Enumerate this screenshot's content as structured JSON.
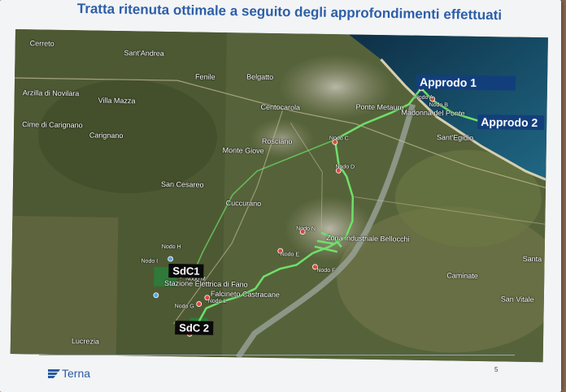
{
  "slide": {
    "title": "Tratta ritenuta ottimale a seguito degli approfondimenti effettuati",
    "page_number": "5"
  },
  "logo": {
    "text": "Terna"
  },
  "callouts": {
    "approdo1": "Approdo 1",
    "approdo2": "Approdo 2",
    "sdc1": "SdC1",
    "sdc2": "SdC 2"
  },
  "places": {
    "cerreto": "Cerreto",
    "sant_andrea": "Sant'Andrea",
    "fenile": "Fenile",
    "belgatto": "Belgatto",
    "arzilla": "Arzilla di Novilara",
    "villa_mazza": "Villa Mazza",
    "cento_carola": "Centocarola",
    "cime_carignano": "Cime di Carignano",
    "carignano": "Carignano",
    "monte_giove": "Monte Giove",
    "rosciano": "Rosciano",
    "san_cesareo": "San Cesareo",
    "sant_egidio": "Sant'Egidio",
    "madonna_ponte": "Madonna del Ponte",
    "ponte_metauro": "Ponte Metauro",
    "zona_industriale": "Zona industriale Bellocchi",
    "stazione_elettrica": "Stazione Elettrica di Fano",
    "falcineto": "Falcineto Castracane",
    "caminate": "Caminate",
    "san_vitale": "San Vitale",
    "lucrezia": "Lucrezia",
    "cuccurano": "Cuccurano",
    "santa": "Santa"
  },
  "nodes": {
    "nodo_a": "Nodo A",
    "nodo_b": "Nodo B",
    "nodo_c": "Nodo C",
    "nodo_d": "Nodo D",
    "nodo_e": "Nodo E",
    "nodo_f": "Nodo F",
    "nodo_g": "Nodo G",
    "nodo_h": "Nodo H",
    "nodo_i": "Nodo I",
    "nodo_l": "Nodo L",
    "nodo_m": "Nodo M",
    "nodo_n": "Nodo N"
  },
  "colors": {
    "route": "#6fe06a",
    "sea": "#1f5d7a",
    "approdo_tag": "#123f7c",
    "title": "#2c5fa8"
  }
}
